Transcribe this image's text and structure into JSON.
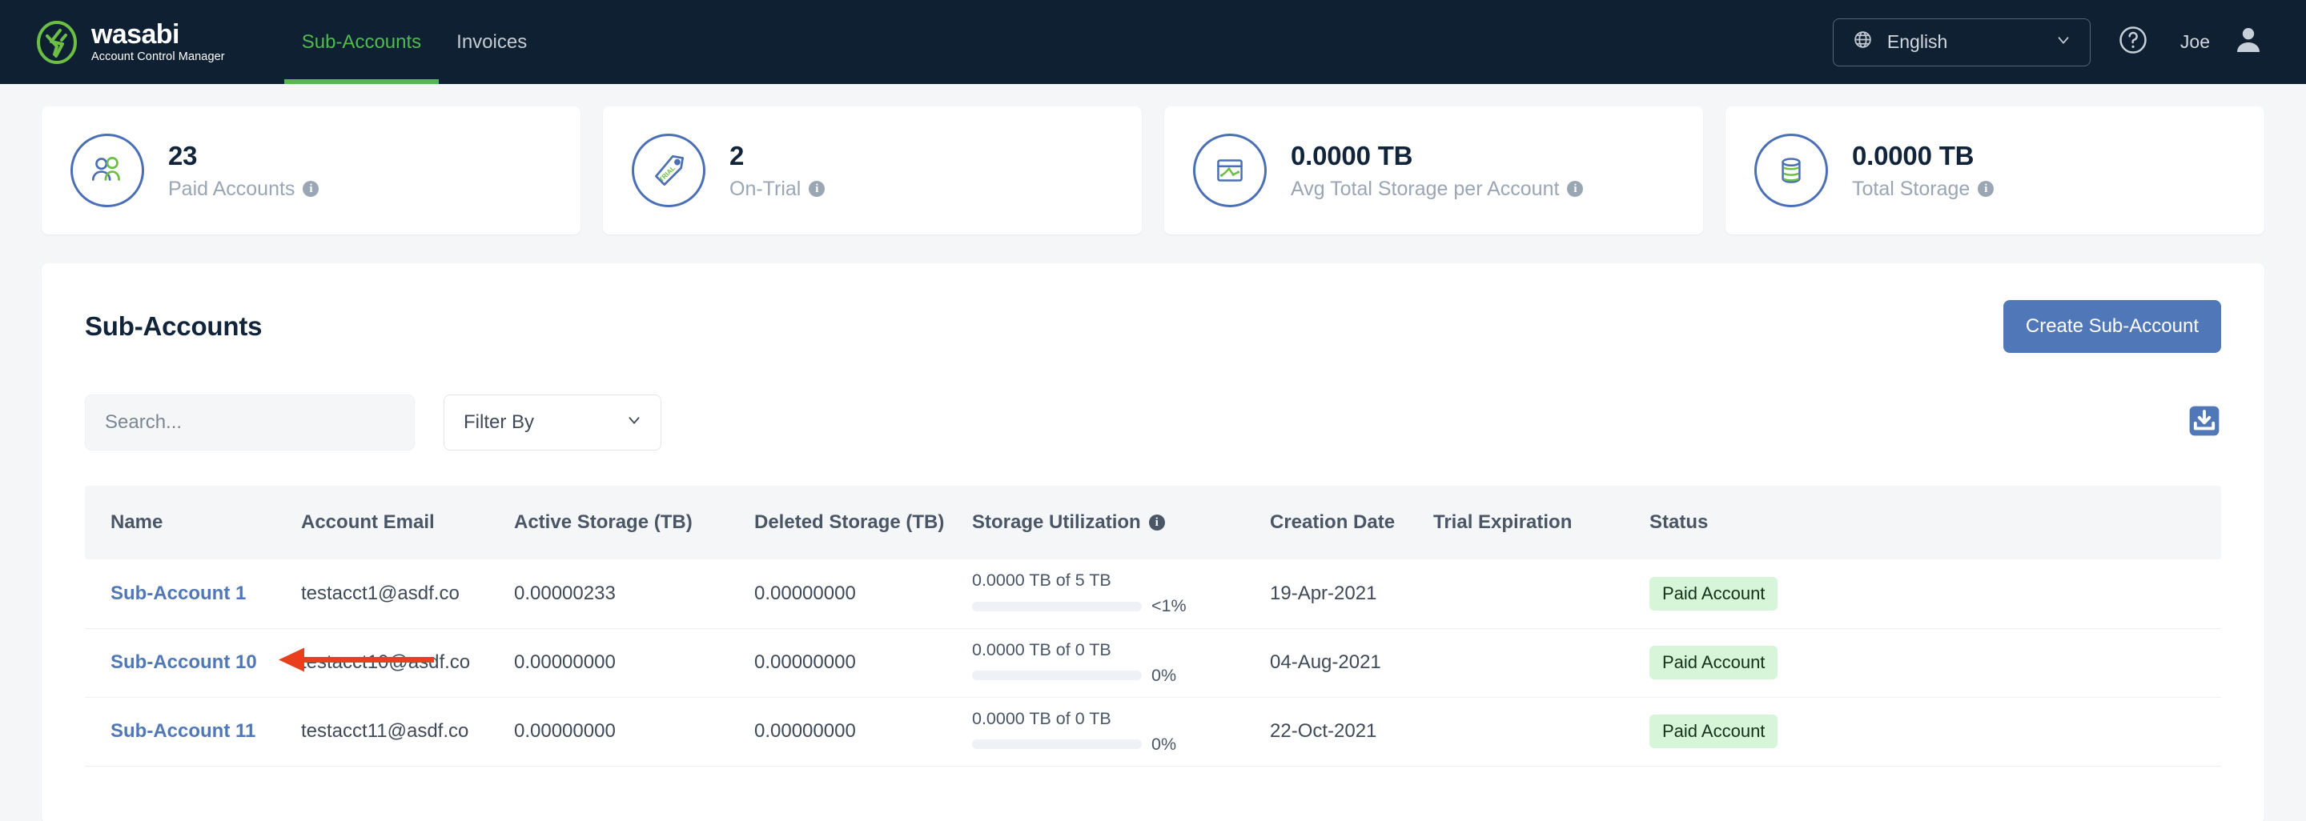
{
  "header": {
    "brand_word": "wasabi",
    "brand_sub": "Account Control Manager",
    "nav": [
      {
        "label": "Sub-Accounts",
        "active": true
      },
      {
        "label": "Invoices",
        "active": false
      }
    ],
    "language": "English",
    "globe_icon": "globe-icon",
    "chevron_icon": "chevron-down-icon",
    "help_icon": "help-circle-icon",
    "user_name": "Joe",
    "avatar_icon": "user-avatar-icon"
  },
  "stats": [
    {
      "value": "23",
      "label": "Paid Accounts",
      "icon": "people-icon",
      "info": "i"
    },
    {
      "value": "2",
      "label": "On-Trial",
      "icon": "trial-tag-icon",
      "info": "i"
    },
    {
      "value": "0.0000 TB",
      "label": "Avg Total Storage per Account",
      "icon": "chart-window-icon",
      "info": "i"
    },
    {
      "value": "0.0000 TB",
      "label": "Total Storage",
      "icon": "database-icon",
      "info": "i"
    }
  ],
  "panel": {
    "title": "Sub-Accounts",
    "create_button": "Create Sub-Account",
    "search_placeholder": "Search...",
    "search_value": "",
    "filter_label": "Filter By",
    "export_icon": "download-export-icon"
  },
  "table": {
    "columns": [
      {
        "label": "Name"
      },
      {
        "label": "Account Email"
      },
      {
        "label": "Active Storage (TB)"
      },
      {
        "label": "Deleted Storage (TB)"
      },
      {
        "label": "Storage Utilization",
        "info": "i"
      },
      {
        "label": "Creation Date"
      },
      {
        "label": "Trial Expiration"
      },
      {
        "label": "Status"
      }
    ],
    "rows": [
      {
        "name": "Sub-Account 1",
        "email": "testacct1@asdf.co",
        "active_storage": "0.00000233",
        "deleted_storage": "0.00000000",
        "utilization_text": "0.0000 TB of 5 TB",
        "utilization_pct_label": "<1%",
        "utilization_fill": 0,
        "creation_date": "19-Apr-2021",
        "trial_expiration": "",
        "status": "Paid Account",
        "annotated": false
      },
      {
        "name": "Sub-Account 10",
        "email": "testacct10@asdf.co",
        "active_storage": "0.00000000",
        "deleted_storage": "0.00000000",
        "utilization_text": "0.0000 TB of 0 TB",
        "utilization_pct_label": "0%",
        "utilization_fill": 0,
        "creation_date": "04-Aug-2021",
        "trial_expiration": "",
        "status": "Paid Account",
        "annotated": true
      },
      {
        "name": "Sub-Account 11",
        "email": "testacct11@asdf.co",
        "active_storage": "0.00000000",
        "deleted_storage": "0.00000000",
        "utilization_text": "0.0000 TB of 0 TB",
        "utilization_pct_label": "0%",
        "utilization_fill": 0,
        "creation_date": "22-Oct-2021",
        "trial_expiration": "",
        "status": "Paid Account",
        "annotated": false
      }
    ]
  },
  "colors": {
    "nav_bg": "#0e2031",
    "accent_green": "#52b950",
    "primary_blue": "#5077b7",
    "page_bg": "#f4f6f8",
    "badge_green_bg": "#d6f5d9",
    "annotation_red": "#e8401c"
  }
}
